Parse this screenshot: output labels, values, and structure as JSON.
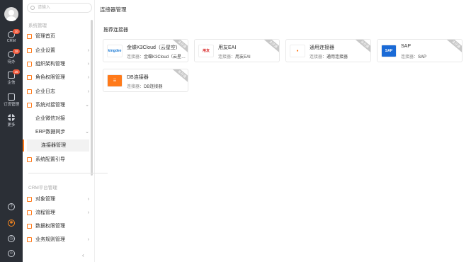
{
  "rail": {
    "items": [
      {
        "label": "CRM",
        "badge": "10"
      },
      {
        "label": "待办",
        "badge": "18"
      },
      {
        "label": "企信",
        "badge": "25"
      },
      {
        "label": "订货管理",
        "badge": ""
      },
      {
        "label": "更多",
        "badge": ""
      }
    ],
    "bottom": [
      "help-icon",
      "settings-icon",
      "clock-icon",
      "contacts-icon"
    ]
  },
  "nav": {
    "search_placeholder": "请输入",
    "group1": "系统管理",
    "items": [
      {
        "label": "管理首页",
        "chevron": false
      },
      {
        "label": "企业设置",
        "chevron": true
      },
      {
        "label": "组织架构管理",
        "chevron": true
      },
      {
        "label": "角色权限管理",
        "chevron": true
      },
      {
        "label": "企业日志",
        "chevron": true
      },
      {
        "label": "系统对接管理",
        "chevron": true
      }
    ],
    "subitems": [
      "企业微信对接",
      "ERP数据同步"
    ],
    "active_item": "连接器管理",
    "after_item": "系统配置引导",
    "group2": "CRM平台管理",
    "group2_items": [
      {
        "label": "对象管理",
        "chevron": true
      },
      {
        "label": "流程管理",
        "chevron": true
      },
      {
        "label": "数据权限管理",
        "chevron": false
      },
      {
        "label": "业务规则管理",
        "chevron": true
      }
    ]
  },
  "main": {
    "title": "连接器管理",
    "section": "推荐连接器",
    "connector_prefix": "连接器：",
    "ribbon": "未开通",
    "cards": [
      {
        "name": "金蝶K3Cloud（云星空）",
        "sub": "金蝶K3Cloud（云星…",
        "logo": "kingdee",
        "logo_color": "#1a7ad6"
      },
      {
        "name": "用友EAI",
        "sub": "用友EAI",
        "logo": "用友",
        "logo_color": "#d92a2a"
      },
      {
        "name": "通用连接器",
        "sub": "通用连接器",
        "logo": "●",
        "logo_color": "#ff7a1a"
      },
      {
        "name": "SAP",
        "sub": "SAP",
        "logo": "SAP",
        "logo_color": "#1a6ad6"
      },
      {
        "name": "DB连接器",
        "sub": "DB连接器",
        "logo": "☰",
        "logo_color": "#ff7a1a"
      }
    ]
  },
  "colors": {
    "accent": "#ff7a1a",
    "rail_bg": "#2b2f36",
    "badge": "#f0583a"
  }
}
